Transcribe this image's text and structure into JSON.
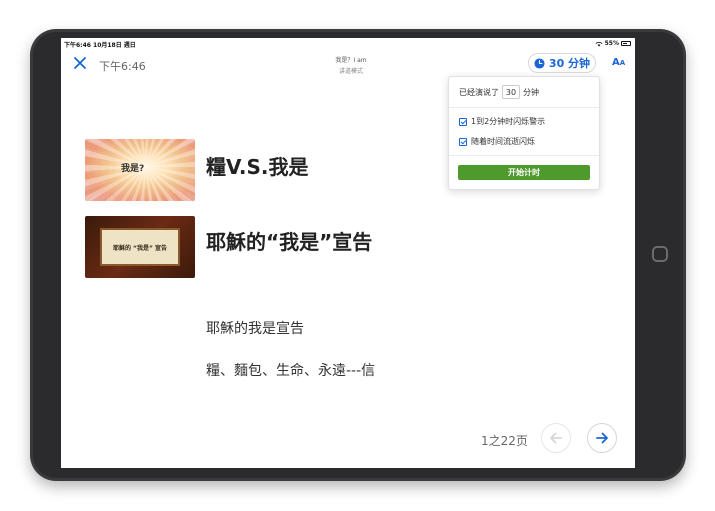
{
  "status_bar": {
    "time_date": "下午6:46  10月18日 週日",
    "battery": "55%"
  },
  "app_bar": {
    "time": "下午6:46",
    "title": "我是？I am",
    "subtitle": "讲道模式",
    "timer_label": "30 分钟",
    "font_size_label_big": "A",
    "font_size_label_small": "A"
  },
  "timer_popover": {
    "already_said_label": "已经演说了",
    "minutes_value": "30",
    "minutes_unit": "分钟",
    "option_flash_warning": "1到2分钟时闪烁警示",
    "option_flash_over_time": "随着时间流逝闪烁",
    "start_button": "开始计时"
  },
  "slide": {
    "thumb1_text": "我是?",
    "heading1": "糧V.S.我是",
    "thumb2_text": "耶穌的 “我是” 宣告",
    "heading2": "耶穌的“我是”宣告",
    "line1": "耶穌的我是宣告",
    "line2": "糧、麵包、生命、永遠---信"
  },
  "pagination": {
    "page_indicator": "1之22页"
  },
  "colors": {
    "accent": "#1a66d6",
    "start_button": "#4f9a2d"
  }
}
